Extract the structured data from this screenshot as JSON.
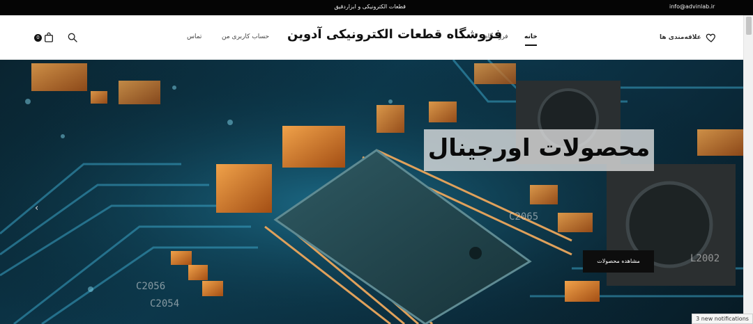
{
  "topbar": {
    "email": "info@advinlab.ir",
    "tagline": "قطعات الکترونیکی و ابزاردقیق"
  },
  "header": {
    "wishlist_label": "علاقه‌مندی ها",
    "nav_home": "خانه",
    "nav_shop": "فروشگاه",
    "site_title": "فروشگاه قطعات الکترونیکی آدوین",
    "nav_account": "حساب کاربری من",
    "nav_contact": "تماس",
    "cart_count": "0"
  },
  "hero": {
    "title": "محصولات اورجینال",
    "cta": "مشاهده محصولات",
    "prev_arrow": "‹"
  },
  "notifications": "3 new notifications",
  "colors": {
    "topbar_bg": "#050505",
    "header_bg": "#ffffff",
    "cta_bg": "#0d0d0d",
    "pcb_teal": "#0c3a4f",
    "component_orange": "#d9822b"
  }
}
